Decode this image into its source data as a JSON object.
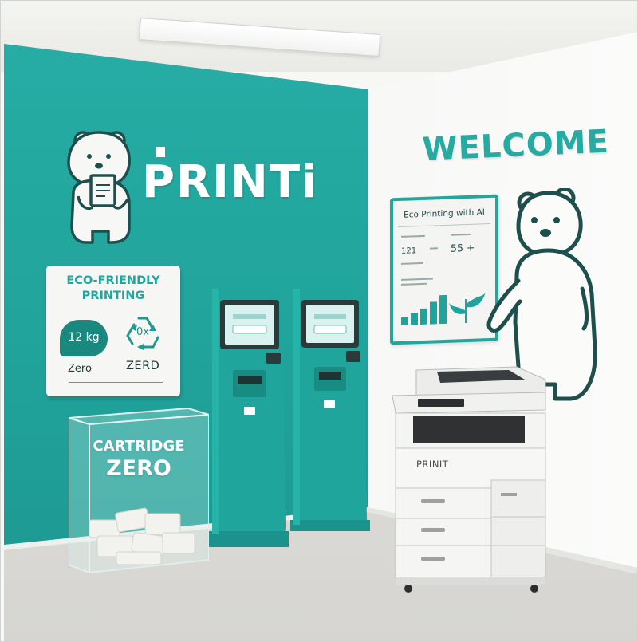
{
  "scene": {
    "description_tags": [
      "store-interior",
      "printing-kiosks",
      "eco-signage"
    ]
  },
  "brand": {
    "name": "PRINTi"
  },
  "welcome_sign": {
    "text": "WELCOME"
  },
  "eco_panel": {
    "title_line1": "ECO-FRIENDLY",
    "title_line2": "PRINTING",
    "badge_value": "12 kg",
    "badge_caption": "Zero",
    "recycle_value": "0x",
    "recycle_caption": "ZERD"
  },
  "dashboard_panel": {
    "title": "Eco Printing with AI",
    "stat_left": "121",
    "stat_right": "55 +"
  },
  "cartridge_bin": {
    "line1": "CARTRIDGE",
    "line2": "ZERO"
  },
  "copier": {
    "brand": "PRINIT"
  },
  "colors": {
    "teal_wall": "#22a69e",
    "teal_dark": "#19897f",
    "right_wall": "#f4f5f3",
    "floor": "#dedcd8",
    "decal_outline": "#1e4f4c",
    "panel_white": "#f6f7f4"
  },
  "icons": [
    "bear-decal-icon",
    "recycle-icon",
    "leaf-icon",
    "ceiling-light-icon"
  ]
}
